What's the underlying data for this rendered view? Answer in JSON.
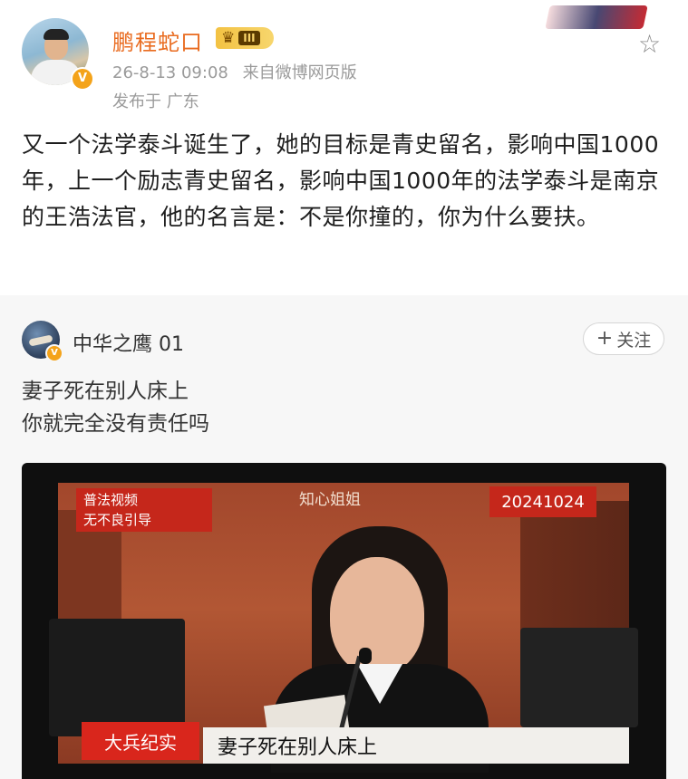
{
  "post": {
    "username": "鹏程蛇口",
    "level_badge": "III",
    "timestamp": "26-8-13 09:08",
    "source": "来自微博网页版",
    "location": "发布于 广东",
    "text": "又一个法学泰斗诞生了，她的目标是青史留名，影响中国1000年，上一个励志青史留名，影响中国1000年的法学泰斗是南京的王浩法官，他的名言是：不是你撞的，你为什么要扶。",
    "verified_mark": "V",
    "favorite_icon": "star-outline-icon"
  },
  "repost": {
    "username": "中华之鹰 01",
    "follow_label": "关注",
    "follow_plus": "+",
    "verified_mark": "V",
    "text_lines": [
      "妻子死在别人床上",
      "你就完全没有责任吗"
    ]
  },
  "video": {
    "tag_line1": "普法视频",
    "tag_line2": "无不良引导",
    "watermark": "知心姐姐",
    "date_tag": "20241024",
    "channel": "大兵纪实",
    "subtitle": "妻子死在别人床上"
  },
  "colors": {
    "username": "#e96b1f",
    "meta": "#9a9a9a",
    "badge_gold": "#f3c243",
    "red_tag": "#c5271b"
  }
}
